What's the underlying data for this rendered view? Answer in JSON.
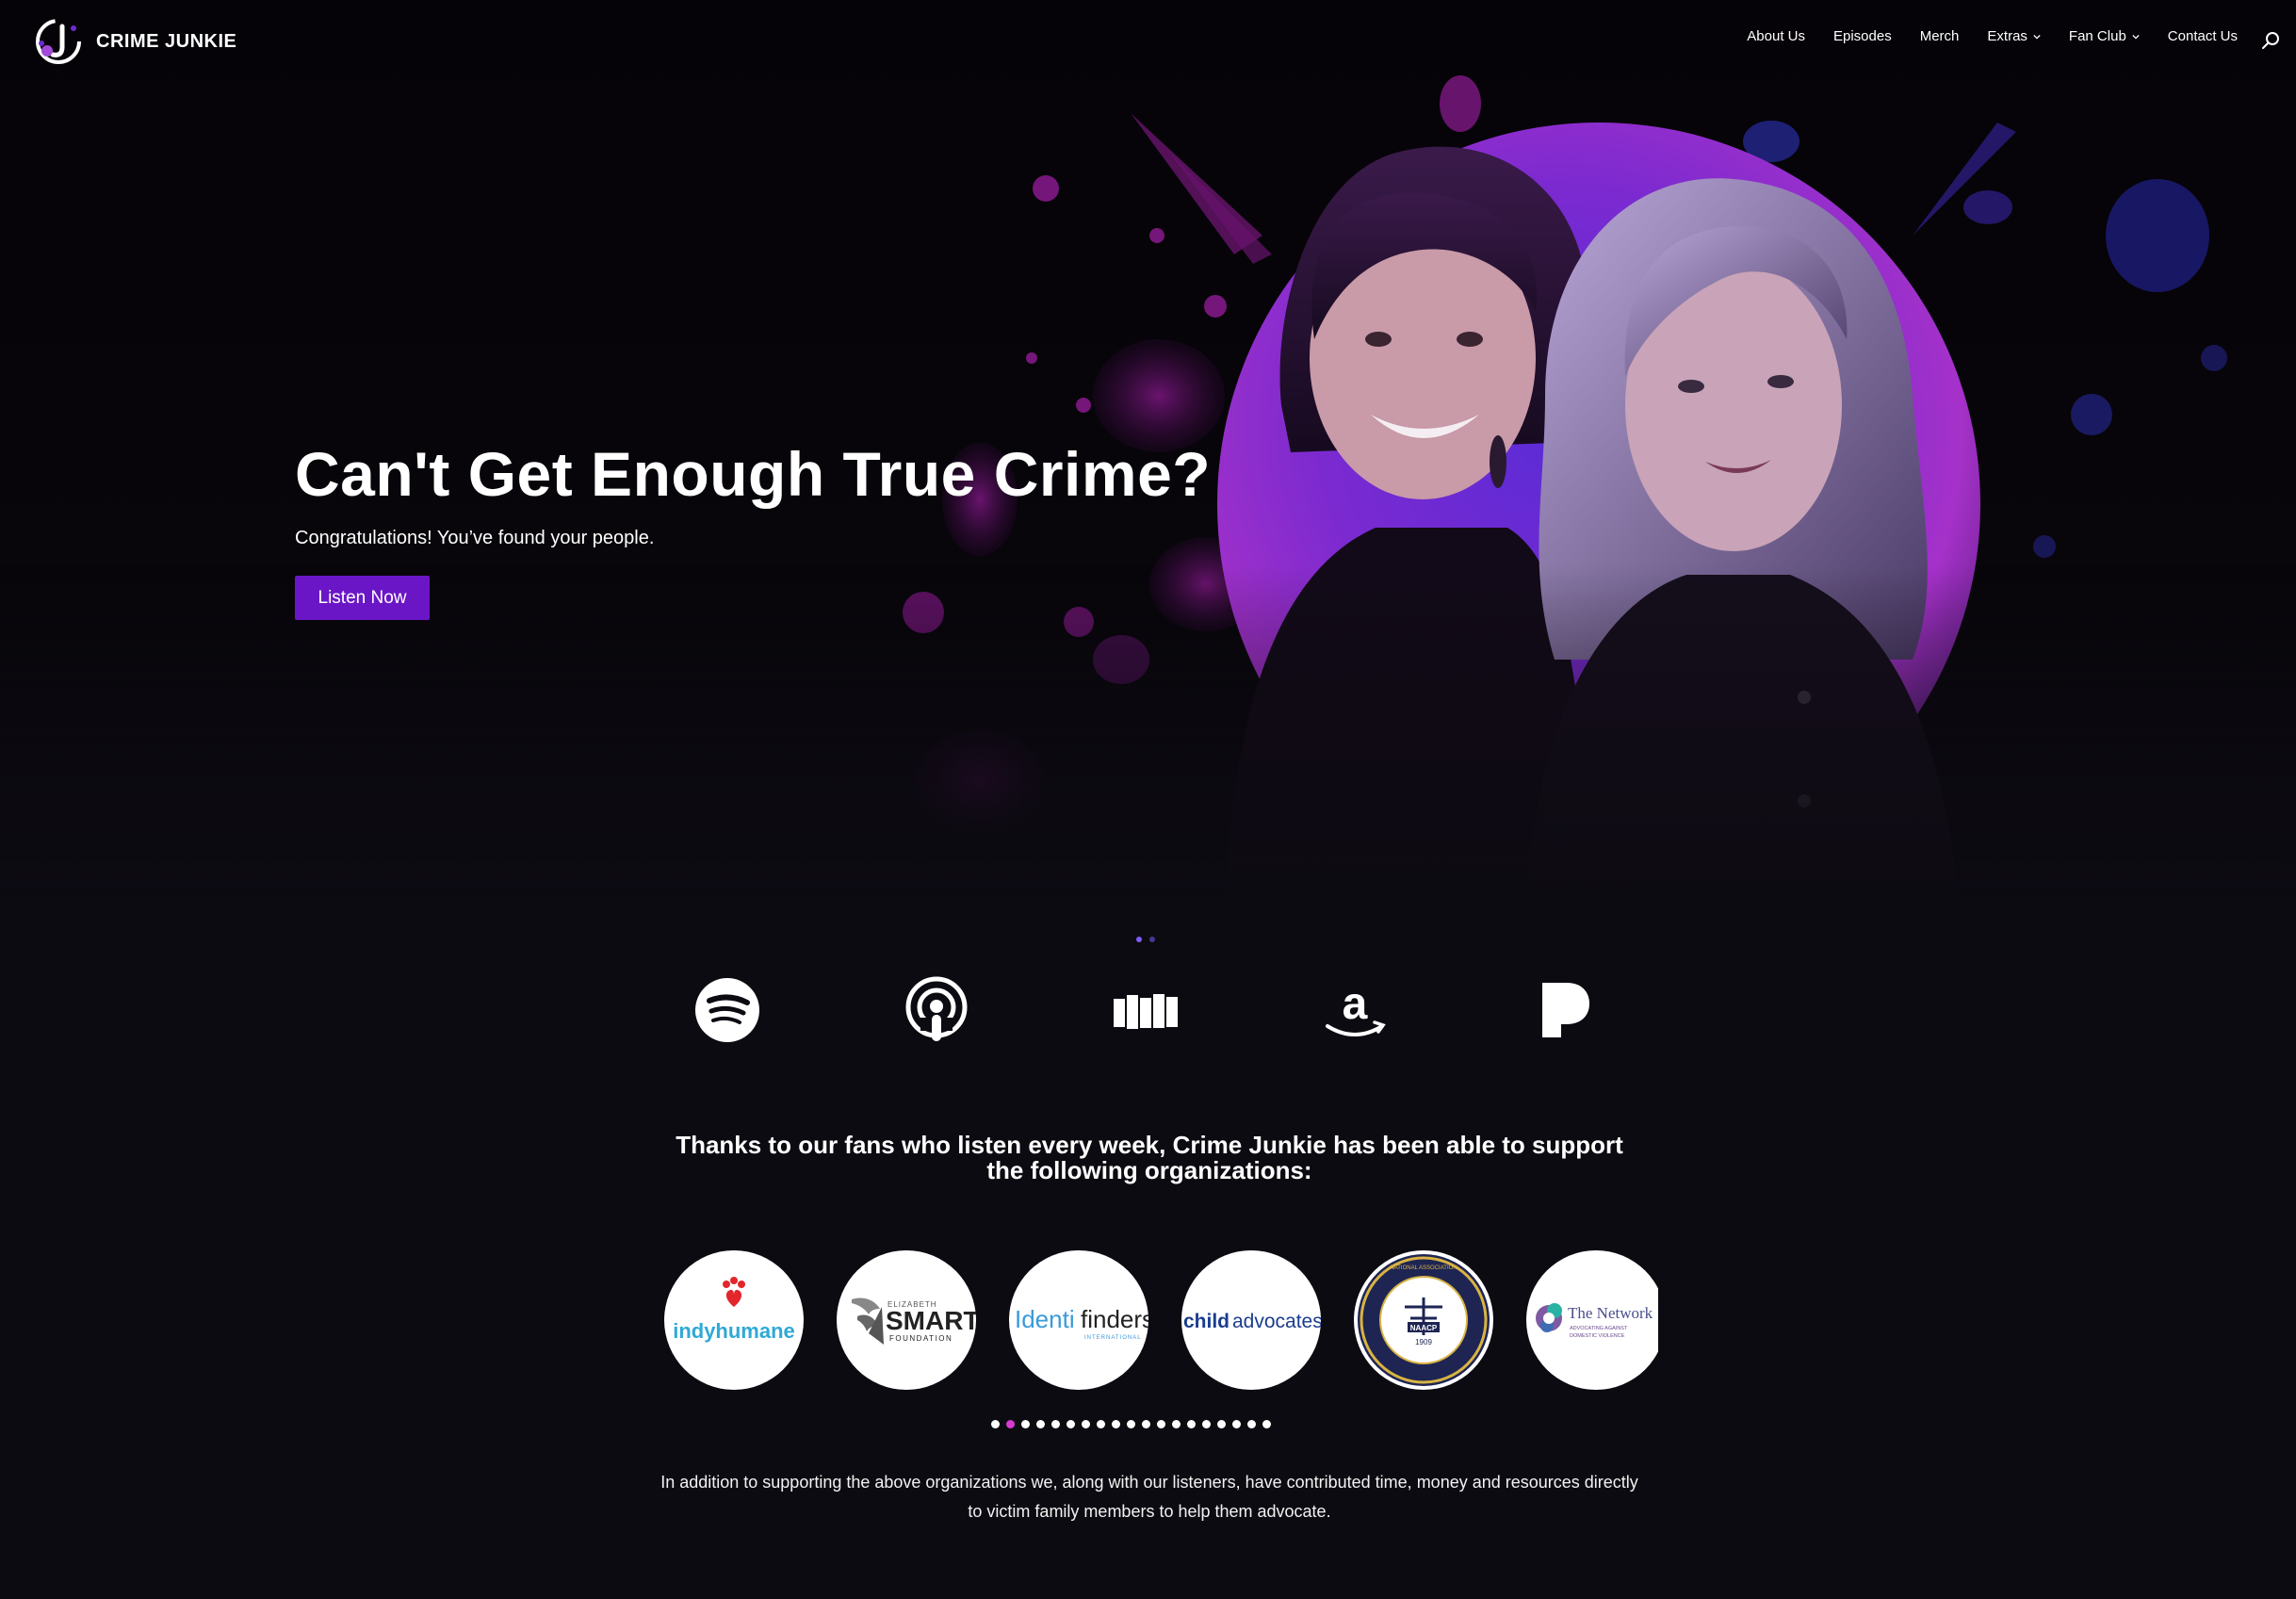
{
  "brand": {
    "name": "CRIME JUNKIE",
    "accent": "#6b16c6",
    "highlight": "#d63bd1"
  },
  "nav": {
    "items": [
      {
        "label": "About Us",
        "has_dropdown": false
      },
      {
        "label": "Episodes",
        "has_dropdown": false
      },
      {
        "label": "Merch",
        "has_dropdown": false
      },
      {
        "label": "Extras",
        "has_dropdown": true
      },
      {
        "label": "Fan Club",
        "has_dropdown": true
      },
      {
        "label": "Contact Us",
        "has_dropdown": false
      }
    ],
    "search_icon": "search-icon"
  },
  "hero": {
    "title": "Can't Get Enough True Crime?",
    "subtitle": "Congratulations! You’ve found your people.",
    "cta": "Listen Now",
    "slide_count": 2,
    "active_slide": 0
  },
  "platforms": [
    {
      "icon": "spotify-icon"
    },
    {
      "icon": "apple-podcasts-icon"
    },
    {
      "icon": "stitcher-icon"
    },
    {
      "icon": "amazon-icon"
    },
    {
      "icon": "pandora-icon"
    }
  ],
  "support": {
    "title": "Thanks to our fans who listen every week, Crime Junkie has been able to support the following organizations:",
    "organizations": [
      {
        "logo_text": "indyhumane"
      },
      {
        "logo_text": "ELIZABETH SMART FOUNDATION"
      },
      {
        "logo_text": "Identifinders INTERNATIONAL"
      },
      {
        "logo_text": "childadvocates"
      },
      {
        "logo_text": "NATIONAL ASSOCIATION FOR THE ADVANCEMENT OF COLORED PEOPLE NAACP FOUNDED 1909"
      },
      {
        "logo_text": "The Network ADVOCATING AGAINST DOMESTIC VIOLENCE"
      }
    ],
    "dots_count": 19,
    "active_dot": 1,
    "note": "In addition to supporting the above organizations we, along with our listeners, have contributed time, money and resources directly to victim family members to help them advocate."
  }
}
